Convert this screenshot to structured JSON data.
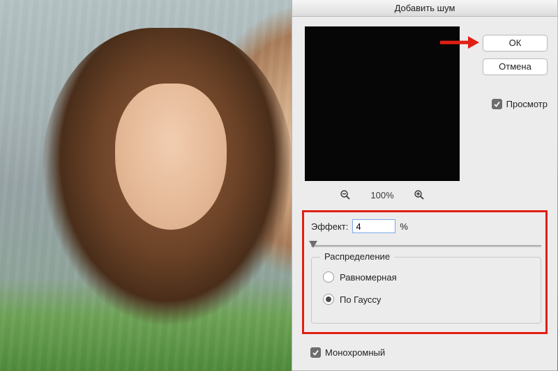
{
  "dialog": {
    "title": "Добавить шум",
    "ok_label": "ОК",
    "cancel_label": "Отмена",
    "preview_label": "Просмотр",
    "preview_checked": true
  },
  "zoom": {
    "level": "100%"
  },
  "effect": {
    "label": "Эффект:",
    "value": "4",
    "unit": "%",
    "slider_position_pct": 1
  },
  "distribution": {
    "title": "Распределение",
    "options": {
      "uniform": "Равномерная",
      "gaussian": "По Гауссу"
    },
    "selected": "gaussian"
  },
  "monochrome": {
    "label": "Монохромный",
    "checked": true
  }
}
